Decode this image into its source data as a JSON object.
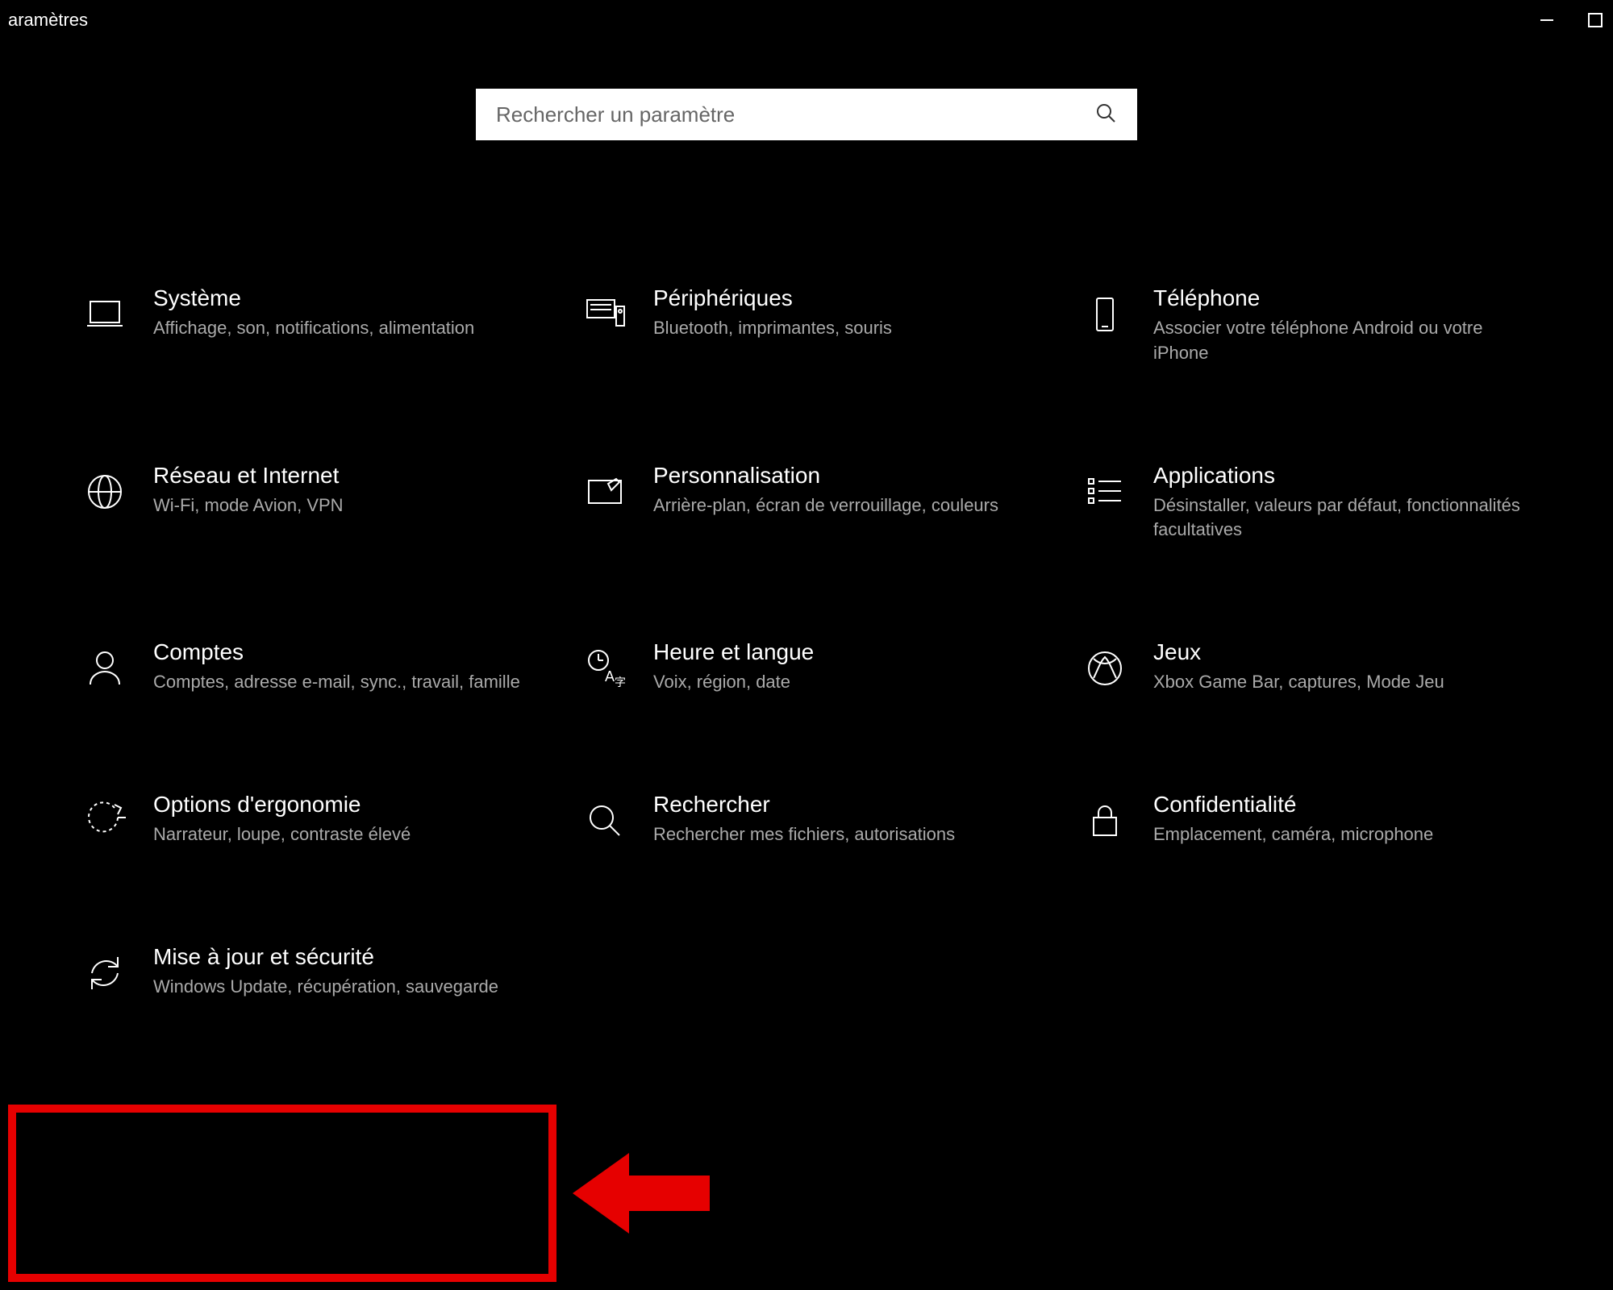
{
  "window": {
    "title": "aramètres"
  },
  "search": {
    "placeholder": "Rechercher un paramètre"
  },
  "categories": [
    {
      "id": "system",
      "icon": "laptop-icon",
      "title": "Système",
      "desc": "Affichage, son, notifications, alimentation"
    },
    {
      "id": "devices",
      "icon": "keyboard-icon",
      "title": "Périphériques",
      "desc": "Bluetooth, imprimantes, souris"
    },
    {
      "id": "phone",
      "icon": "phone-icon",
      "title": "Téléphone",
      "desc": "Associer votre téléphone Android ou votre iPhone"
    },
    {
      "id": "network",
      "icon": "globe-icon",
      "title": "Réseau et Internet",
      "desc": "Wi-Fi, mode Avion, VPN"
    },
    {
      "id": "personal",
      "icon": "personalize-icon",
      "title": "Personnalisation",
      "desc": "Arrière-plan, écran de verrouillage, couleurs"
    },
    {
      "id": "apps",
      "icon": "apps-icon",
      "title": "Applications",
      "desc": "Désinstaller, valeurs par défaut, fonctionnalités facultatives"
    },
    {
      "id": "accounts",
      "icon": "person-icon",
      "title": "Comptes",
      "desc": "Comptes, adresse e-mail, sync., travail, famille"
    },
    {
      "id": "time",
      "icon": "time-lang-icon",
      "title": "Heure et langue",
      "desc": "Voix, région, date"
    },
    {
      "id": "gaming",
      "icon": "xbox-icon",
      "title": "Jeux",
      "desc": "Xbox Game Bar, captures, Mode Jeu"
    },
    {
      "id": "ease",
      "icon": "ease-icon",
      "title": "Options d'ergonomie",
      "desc": "Narrateur, loupe, contraste élevé"
    },
    {
      "id": "search-cat",
      "icon": "magnifier-icon",
      "title": "Rechercher",
      "desc": "Rechercher mes fichiers, autorisations"
    },
    {
      "id": "privacy",
      "icon": "lock-icon",
      "title": "Confidentialité",
      "desc": "Emplacement, caméra, microphone"
    },
    {
      "id": "update",
      "icon": "update-icon",
      "title": "Mise à jour et sécurité",
      "desc": "Windows Update, récupération, sauvegarde"
    }
  ]
}
